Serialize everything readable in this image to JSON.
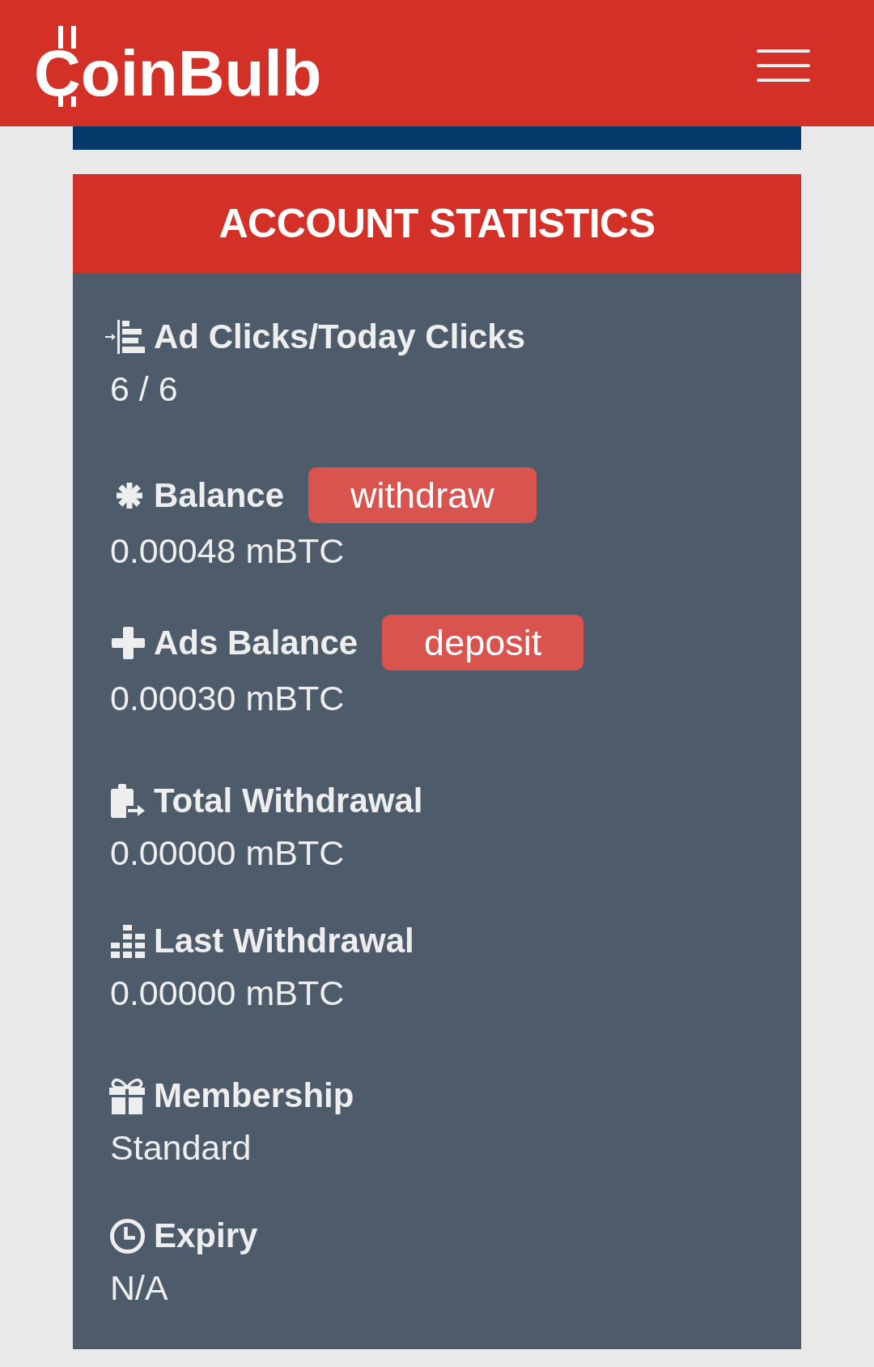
{
  "header": {
    "logo": "CoinBulb"
  },
  "panel": {
    "title": "ACCOUNT STATISTICS",
    "groups": [
      {
        "items": [
          {
            "label": "Ad Clicks/Today Clicks",
            "value": "6 / 6"
          }
        ]
      },
      {
        "items": [
          {
            "label": "Balance",
            "button": "withdraw",
            "value": "0.00048 mBTC"
          },
          {
            "label": "Ads Balance",
            "button": "deposit",
            "value": "0.00030 mBTC"
          }
        ]
      },
      {
        "items": [
          {
            "label": "Total Withdrawal",
            "value": "0.00000 mBTC"
          },
          {
            "label": "Last Withdrawal",
            "value": "0.00000 mBTC"
          }
        ]
      },
      {
        "items": [
          {
            "label": "Membership",
            "value": "Standard"
          },
          {
            "label": "Expiry",
            "value": "N/A"
          }
        ]
      }
    ]
  }
}
